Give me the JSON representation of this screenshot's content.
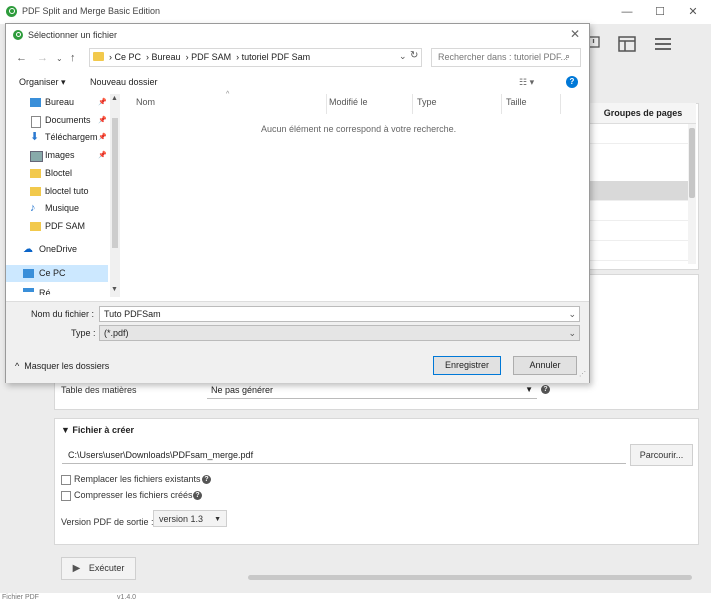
{
  "app": {
    "title": "PDF Split and Merge Basic Edition",
    "minimize_glyph": "—",
    "maximize_glyph": "☐",
    "close_glyph": "✕"
  },
  "table": {
    "header_groups": "Groupes de pages"
  },
  "options": {
    "toc_label": "Table des matières",
    "toc_value": "Ne pas générer"
  },
  "destination": {
    "section_title": "Fichier à créer",
    "path_value": "C:\\Users\\user\\Downloads\\PDFsam_merge.pdf",
    "browse_label": "Parcourir...",
    "overwrite_label": "Remplacer les fichiers existants",
    "compress_label": "Compresser les fichiers créés",
    "version_label": "Version PDF de sortie :",
    "version_value": "version 1.3"
  },
  "run": {
    "label": "Exécuter"
  },
  "footer": {
    "left_text": "Fichier PDF",
    "right_text": "v1.4.0"
  },
  "dialog": {
    "title": "Sélectionner un fichier",
    "breadcrumb": [
      "Ce PC",
      "Bureau",
      "PDF SAM",
      "tutoriel PDF Sam"
    ],
    "search_placeholder": "Rechercher dans : tutoriel PDF...",
    "organize_label": "Organiser ▾",
    "new_folder_label": "Nouveau dossier",
    "nav_items": [
      {
        "label": "Bureau",
        "pinned": true
      },
      {
        "label": "Documents",
        "pinned": true
      },
      {
        "label": "Téléchargements",
        "pinned": true
      },
      {
        "label": "Images",
        "pinned": true
      },
      {
        "label": "Bloctel",
        "pinned": false
      },
      {
        "label": "bloctel tuto",
        "pinned": false
      },
      {
        "label": "Musique",
        "pinned": false
      },
      {
        "label": "PDF SAM",
        "pinned": false
      },
      {
        "label": "OneDrive",
        "pinned": false
      },
      {
        "label": "Ce PC",
        "pinned": false
      },
      {
        "label": "Ré...",
        "pinned": false
      }
    ],
    "columns": [
      "Nom",
      "Modifié le",
      "Type",
      "Taille"
    ],
    "empty_message": "Aucun élément ne correspond à votre recherche.",
    "filename_label": "Nom du fichier :",
    "filename_value": "Tuto PDFSam",
    "type_label": "Type :",
    "type_value": "(*.pdf)",
    "hide_folders_label": "Masquer les dossiers",
    "save_label": "Enregistrer",
    "cancel_label": "Annuler"
  },
  "colors": {
    "accent": "#0078d7",
    "logo_green": "#2e9c3c",
    "folder_yellow": "#f2c94c",
    "selected_row": "#cce8ff"
  }
}
